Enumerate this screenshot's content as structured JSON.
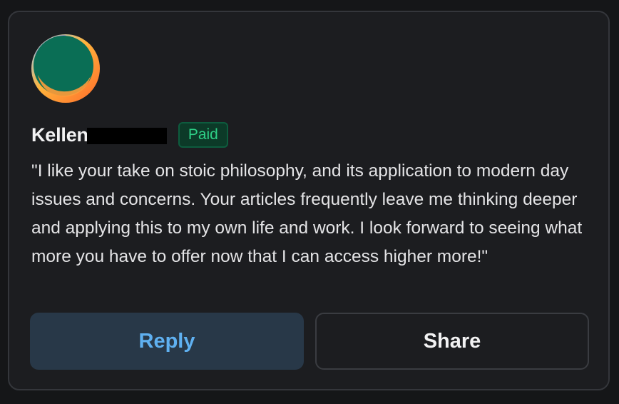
{
  "comment": {
    "author_name": "Kellen",
    "badge": "Paid",
    "text": "\"I like your take on stoic philosophy, and its application to modern day issues and concerns. Your articles frequently leave me thinking deeper and applying this to my own life and work. I look forward to seeing what more you have to offer now that I can access higher more!\""
  },
  "actions": {
    "reply_label": "Reply",
    "share_label": "Share"
  },
  "colors": {
    "card_background": "#1c1d20",
    "badge_text": "#2ecf86",
    "reply_text": "#5fb0f0",
    "reply_background": "#283848",
    "avatar_primary": "#0a6e55"
  }
}
